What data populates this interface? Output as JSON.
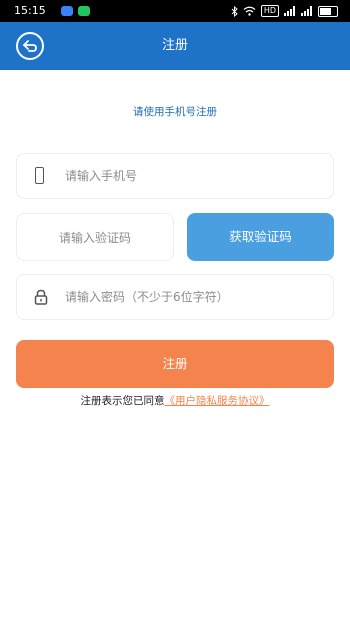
{
  "status_bar": {
    "time": "15:15",
    "hd_label": "HD"
  },
  "header": {
    "title": "注册"
  },
  "subtitle": "请使用手机号注册",
  "form": {
    "phone_placeholder": "请输入手机号",
    "code_placeholder": "请输入验证码",
    "get_code_label": "获取验证码",
    "password_placeholder": "请输入密码（不少于6位字符）",
    "register_label": "注册"
  },
  "agreement": {
    "prefix": "注册表示您已同意",
    "link": "《用户隐私服务协议》"
  },
  "colors": {
    "header_bg": "#1e73c8",
    "code_button_bg": "#4a9fe1",
    "register_button_bg": "#f5834e",
    "subtitle_text": "#1f6fb5"
  },
  "icons": {
    "back": "back-arrow-icon",
    "phone": "phone-icon",
    "lock": "lock-icon"
  }
}
